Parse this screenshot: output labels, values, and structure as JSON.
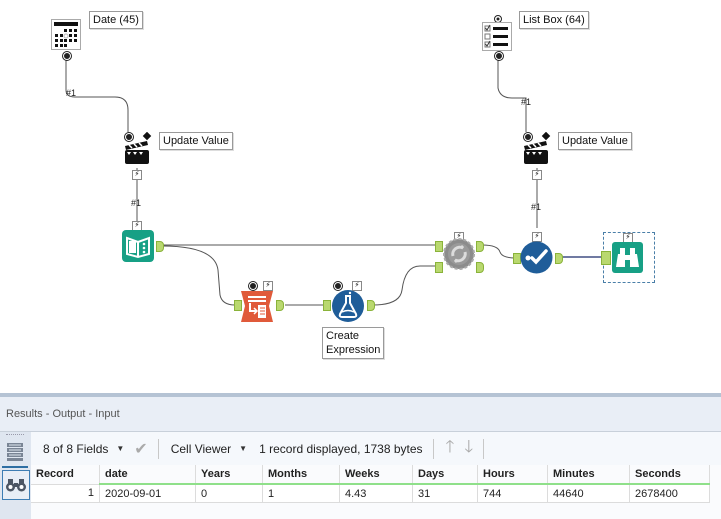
{
  "canvas": {
    "tools": {
      "date": {
        "label": "Date (45)",
        "icon": "calendar-icon"
      },
      "update_value_left": {
        "label": "Update Value",
        "icon": "clapperboard-icon"
      },
      "input": {
        "icon": "book-input-icon"
      },
      "formula_table": {
        "icon": "multi-row-formula-icon"
      },
      "create_expression": {
        "label": "Create\nExpression",
        "label_line1": "Create",
        "label_line2": "Expression",
        "icon": "flask-icon"
      },
      "macro": {
        "icon": "gear-cycle-icon"
      },
      "list_box": {
        "label": "List Box (64)",
        "icon": "listbox-icon"
      },
      "update_value_right": {
        "label": "Update Value",
        "icon": "clapperboard-icon"
      },
      "select_check": {
        "icon": "check-circle-icon"
      },
      "browse": {
        "icon": "binoculars-icon"
      }
    },
    "wire_labels": [
      "#1",
      "#1",
      "#1",
      "#1"
    ],
    "bolt_glyph": "⚡",
    "colors": {
      "teal": "#17a085",
      "blue": "#1f5d99",
      "orange": "#e05a3a",
      "gray": "#8c8c8c",
      "anchor": "#b9d86f"
    }
  },
  "results": {
    "title": "Results - Output - Input",
    "toolbar": {
      "fields": "8 of 8 Fields",
      "viewer": "Cell Viewer",
      "status": "1 record displayed, 1738 bytes"
    },
    "table": {
      "headers": [
        "Record",
        "date",
        "Years",
        "Months",
        "Weeks",
        "Days",
        "Hours",
        "Minutes",
        "Seconds"
      ],
      "rows": [
        [
          "1",
          "2020-09-01",
          "0",
          "1",
          "4.43",
          "31",
          "744",
          "44640",
          "2678400"
        ]
      ]
    }
  }
}
